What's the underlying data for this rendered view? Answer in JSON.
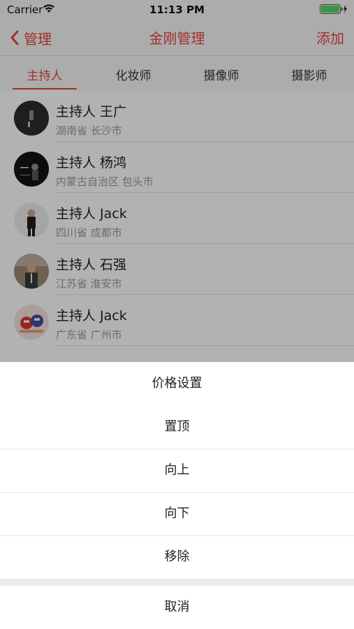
{
  "status_bar": {
    "carrier": "Carrier",
    "time": "11:13 PM",
    "battery_color": "#4cd964"
  },
  "nav": {
    "back_label": "管理",
    "title": "金刚管理",
    "add_label": "添加",
    "accent_color": "#e8453c"
  },
  "tabs": [
    {
      "label": "主持人",
      "active": true
    },
    {
      "label": "化妆师",
      "active": false
    },
    {
      "label": "摄像师",
      "active": false
    },
    {
      "label": "摄影师",
      "active": false
    }
  ],
  "list": [
    {
      "name": "主持人 王广",
      "location": "湖南省 长沙市"
    },
    {
      "name": "主持人 杨鸿",
      "location": "内蒙古自治区 包头市"
    },
    {
      "name": "主持人 Jack",
      "location": "四川省 成都市"
    },
    {
      "name": "主持人 石强",
      "location": "江苏省 淮安市"
    },
    {
      "name": "主持人 Jack",
      "location": "广东省 广州市"
    }
  ],
  "action_sheet": {
    "title": "价格设置",
    "actions": [
      "置顶",
      "向上",
      "向下",
      "移除"
    ],
    "cancel": "取消"
  }
}
